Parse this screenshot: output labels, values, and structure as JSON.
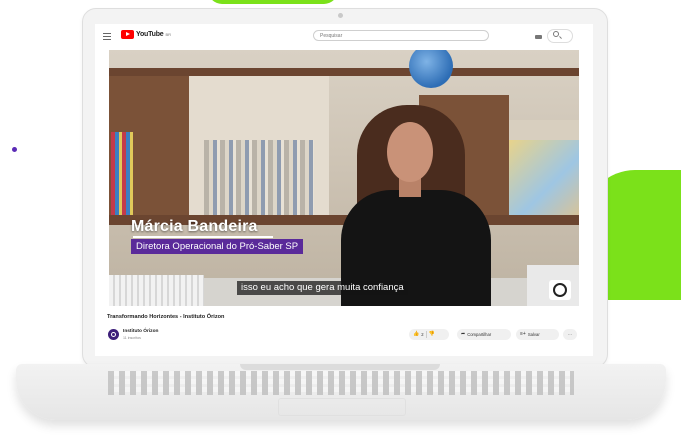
{
  "header": {
    "logo_text": "YouTube",
    "logo_superscript": "BR",
    "search_placeholder": "Pesquisar"
  },
  "video": {
    "lower_third_name": "Márcia Bandeira",
    "lower_third_role": "Diretora Operacional do Pró-Saber SP",
    "caption": "isso eu acho que gera muita confiança"
  },
  "meta": {
    "title": "Transformando Horizontes - Instituto Órizon",
    "channel_name": "Instituto Órizon",
    "channel_subs": "11 inscritos"
  },
  "actions": {
    "like_count": "2",
    "share_label": "Compartilhar",
    "save_label": "Salvar",
    "more_label": "···"
  },
  "icons": {
    "menu": "hamburger-icon",
    "search": "search-icon",
    "keyboard": "keyboard-icon",
    "like": "thumbs-up-icon",
    "dislike": "thumbs-down-icon",
    "share": "share-arrow-icon",
    "save": "save-icon"
  },
  "colors": {
    "accent_green": "#7be11a",
    "lower_third_purple": "#5a2a9a",
    "youtube_red": "#ff0000"
  }
}
